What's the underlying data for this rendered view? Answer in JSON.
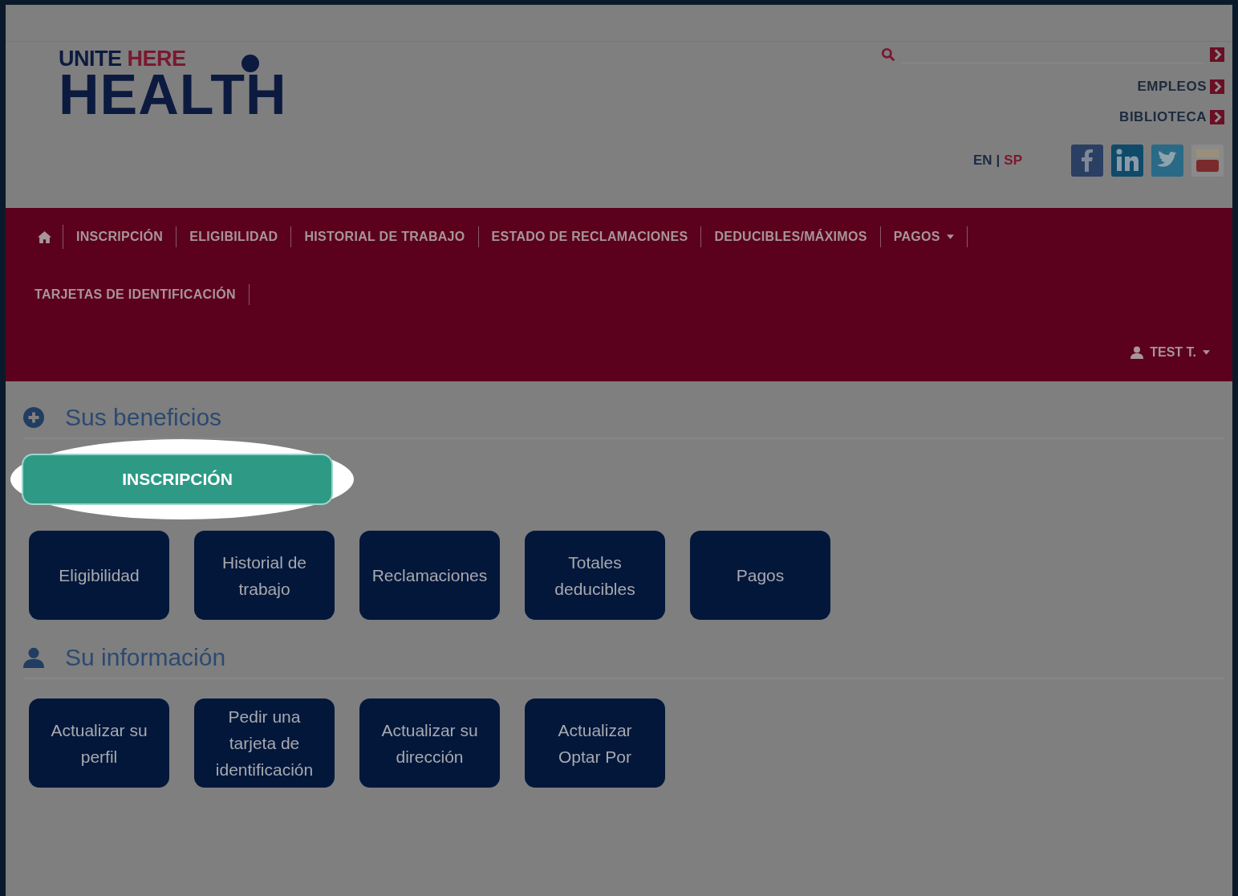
{
  "header": {
    "logo": {
      "word_1": "UNITE",
      "word_2": "HERE",
      "word_3": "HEALTH"
    },
    "utility_links": [
      "EMPLEOS",
      "BIBLIOTECA"
    ],
    "languages": [
      {
        "label": "EN",
        "selected": false
      },
      {
        "label": "SP",
        "selected": true
      }
    ],
    "language_separator": "|"
  },
  "nav": {
    "items": [
      {
        "label": "INSCRIPCIÓN",
        "dropdown": false
      },
      {
        "label": "ELIGIBILIDAD",
        "dropdown": false
      },
      {
        "label": "HISTORIAL DE TRABAJO",
        "dropdown": false
      },
      {
        "label": "ESTADO DE RECLAMACIONES",
        "dropdown": false
      },
      {
        "label": "DEDUCIBLES/MÁXIMOS",
        "dropdown": false
      },
      {
        "label": "PAGOS",
        "dropdown": true
      },
      {
        "label": "TARJETAS DE IDENTIFICACIÓN",
        "dropdown": false
      }
    ],
    "user": {
      "name": "TEST T.",
      "dropdown": true
    }
  },
  "sections": [
    {
      "title": "Sus beneficios",
      "primary_button": {
        "label": "INSCRIPCIÓN",
        "highlighted": true
      },
      "tiles": [
        "Eligibilidad",
        "Historial de trabajo",
        "Reclamaciones",
        "Totales deducibles",
        "Pagos"
      ]
    },
    {
      "title": "Su información",
      "tiles": [
        "Actualizar su perfil",
        "Pedir una tarjeta de identificación",
        "Actualizar su dirección",
        "Actualizar Optar Por"
      ]
    }
  ]
}
